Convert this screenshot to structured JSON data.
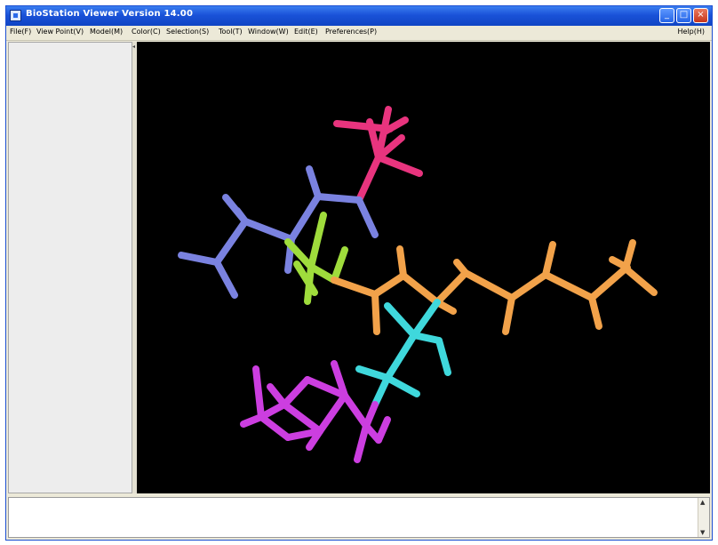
{
  "window": {
    "title": "BioStation Viewer Version 14.00",
    "controls": {
      "minimize": "_",
      "maximize": "□",
      "close": "×"
    }
  },
  "menubar": {
    "items": [
      "File(F)",
      "View Point(V)",
      "Model(M)",
      "Color(C)",
      "Selection(S)",
      "Tool(T)",
      "Window(W)",
      "Edit(E)",
      "Preferences(P)"
    ],
    "help": "Help(H)"
  },
  "molecule": {
    "fragment_colors": {
      "pink": "#e8347e",
      "blue": "#7a82e0",
      "green": "#9fdc3c",
      "orange": "#f2a24a",
      "cyan": "#3fd8dc",
      "magenta": "#cc3ee0"
    },
    "background": "#000000"
  },
  "icons": {
    "app": "app-icon",
    "scroll_up": "▲",
    "scroll_down": "▼",
    "split_arrow": "◂"
  }
}
